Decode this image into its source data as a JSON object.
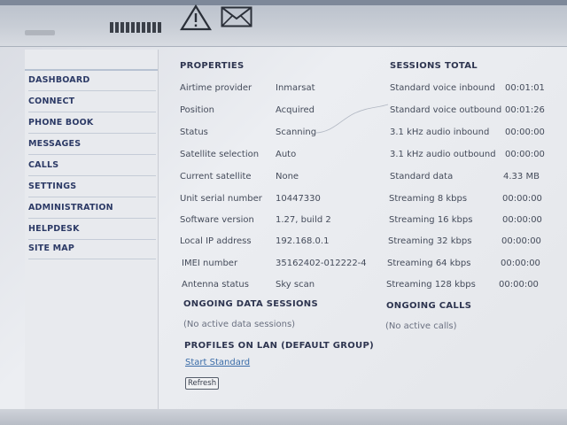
{
  "sidebar": {
    "items": [
      {
        "label": "DASHBOARD"
      },
      {
        "label": "CONNECT"
      },
      {
        "label": "PHONE BOOK"
      },
      {
        "label": "MESSAGES"
      },
      {
        "label": "CALLS"
      },
      {
        "label": "SETTINGS"
      },
      {
        "label": "ADMINISTRATION"
      },
      {
        "label": "HELPDESK"
      },
      {
        "label": "SITE MAP"
      }
    ]
  },
  "header": {
    "icons": [
      "signal-strength-icon",
      "warning-icon",
      "mail-icon"
    ]
  },
  "properties": {
    "title": "PROPERTIES",
    "rows": [
      {
        "label": "Airtime provider",
        "value": "Inmarsat"
      },
      {
        "label": "Position",
        "value": "Acquired"
      },
      {
        "label": "Status",
        "value": "Scanning"
      },
      {
        "label": "Satellite selection",
        "value": "Auto"
      },
      {
        "label": "Current satellite",
        "value": "None"
      },
      {
        "label": "Unit serial number",
        "value": "10447330"
      },
      {
        "label": "Software version",
        "value": "1.27, build 2"
      },
      {
        "label": "Local IP address",
        "value": "192.168.0.1"
      },
      {
        "label": "IMEI number",
        "value": "35162402-012222-4"
      },
      {
        "label": "Antenna status",
        "value": "Sky scan"
      }
    ]
  },
  "sessions": {
    "title": "SESSIONS TOTAL",
    "rows": [
      {
        "label": "Standard voice inbound",
        "value": "00:01:01"
      },
      {
        "label": "Standard voice outbound",
        "value": "00:01:26"
      },
      {
        "label": "3.1 kHz audio inbound",
        "value": "00:00:00"
      },
      {
        "label": "3.1 kHz audio outbound",
        "value": "00:00:00"
      },
      {
        "label": "Standard data",
        "value": "4.33 MB"
      },
      {
        "label": "Streaming 8 kbps",
        "value": "00:00:00"
      },
      {
        "label": "Streaming 16 kbps",
        "value": "00:00:00"
      },
      {
        "label": "Streaming 32 kbps",
        "value": "00:00:00"
      },
      {
        "label": "Streaming 64 kbps",
        "value": "00:00:00"
      },
      {
        "label": "Streaming 128 kbps",
        "value": "00:00:00"
      }
    ]
  },
  "ongoing_data": {
    "title": "ONGOING DATA SESSIONS",
    "empty": "(No active data sessions)"
  },
  "ongoing_calls": {
    "title": "ONGOING CALLS",
    "empty": "(No active calls)"
  },
  "profiles": {
    "title": "PROFILES ON LAN (DEFAULT GROUP)",
    "link": "Start Standard",
    "refresh_label": "Refresh"
  },
  "colors": {
    "nav_text": "#2c3a66",
    "link": "#3a6ca8",
    "background": "#e4e6ea"
  }
}
